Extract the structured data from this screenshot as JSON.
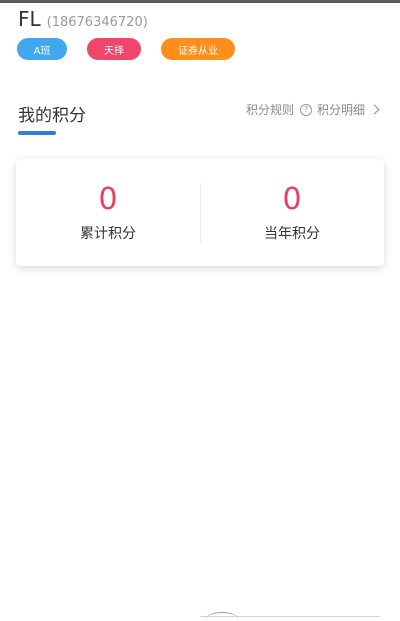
{
  "user": {
    "name": "FL",
    "phone": "(18676346720)"
  },
  "tags": [
    {
      "label": "A班",
      "color": "#42a8ee"
    },
    {
      "label": "天择",
      "color": "#f2456b"
    },
    {
      "label": "证券从业",
      "color": "#ff8f1a"
    }
  ],
  "points_section": {
    "title": "我的积分",
    "rules_link": "积分规则",
    "details_link": "积分明细",
    "accent_color": "#2f7ed8"
  },
  "points": {
    "total": {
      "value": "0",
      "label": "累计积分"
    },
    "current_year": {
      "value": "0",
      "label": "当年积分"
    },
    "value_color": "#e83e63"
  }
}
